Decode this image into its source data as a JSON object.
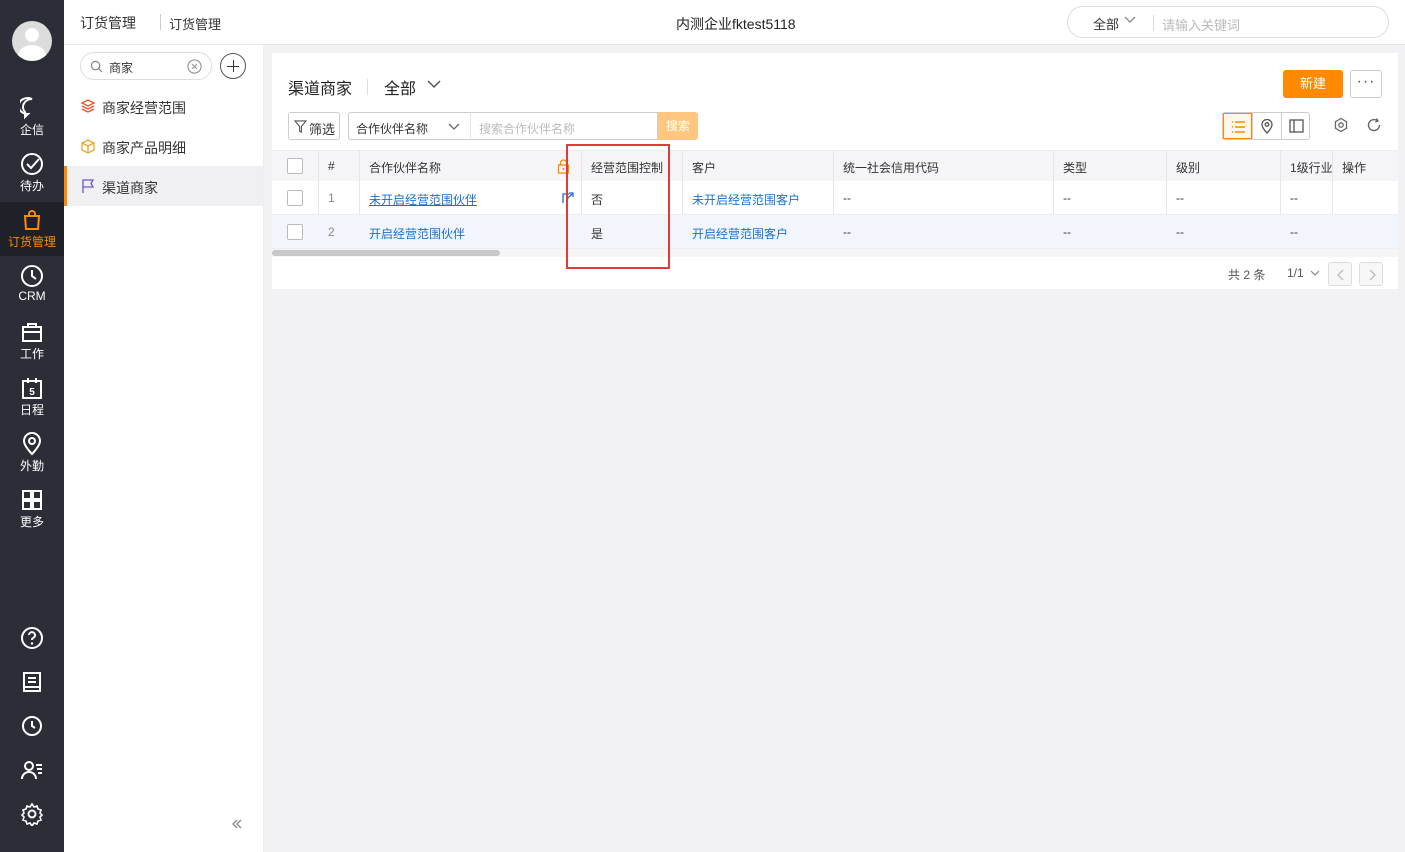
{
  "leftnav": {
    "items": [
      {
        "label": "企信",
        "icon": "chat-bubble-icon"
      },
      {
        "label": "待办",
        "icon": "check-circle-icon"
      },
      {
        "label": "订货管理",
        "icon": "shopping-bag-icon",
        "active": true
      },
      {
        "label": "CRM",
        "icon": "clock-pie-icon"
      },
      {
        "label": "工作",
        "icon": "briefcase-icon"
      },
      {
        "label": "日程",
        "icon": "calendar-icon",
        "calendar_day": "5"
      },
      {
        "label": "外勤",
        "icon": "location-pin-icon"
      },
      {
        "label": "更多",
        "icon": "grid-icon"
      }
    ],
    "bottom_icons": [
      "help-icon",
      "notebook-icon",
      "history-icon",
      "contacts-icon",
      "settings-icon"
    ]
  },
  "topbar": {
    "crumb_app": "订货管理",
    "crumb_page": "订货管理",
    "company": "内测企业fktest5118",
    "search_scope": "全部",
    "search_placeholder": "请输入关键词"
  },
  "subside": {
    "search_value": "商家",
    "items": [
      {
        "label": "商家经营范围",
        "icon": "layers-icon"
      },
      {
        "label": "商家产品明细",
        "icon": "box-icon"
      },
      {
        "label": "渠道商家",
        "icon": "flag-icon",
        "active": true
      }
    ]
  },
  "main": {
    "title": "渠道商家",
    "scope": "全部",
    "new_button": "新建",
    "more_button": "···",
    "filter_button": "筛选",
    "field_select": "合作伙伴名称",
    "search_placeholder": "搜索合作伙伴名称",
    "search_button": "搜索"
  },
  "table": {
    "columns": [
      "#",
      "合作伙伴名称",
      "经营范围控制",
      "客户",
      "统一社会信用代码",
      "类型",
      "级别",
      "1级行业",
      "操作"
    ],
    "rows": [
      {
        "num": "1",
        "partner": "未开启经营范围伙伴",
        "scope_control": "否",
        "customer": "未开启经营范围客户",
        "credit_code": "--",
        "type": "--",
        "level": "--",
        "industry": "--"
      },
      {
        "num": "2",
        "partner": "开启经营范围伙伴",
        "scope_control": "是",
        "customer": "开启经营范围客户",
        "credit_code": "--",
        "type": "--",
        "level": "--",
        "industry": "--"
      }
    ]
  },
  "pagination": {
    "total": "共 2 条",
    "page": "1/1"
  },
  "colors": {
    "accent": "#ff8a00",
    "nav_bg": "#2b2e36",
    "link": "#1a6fd1",
    "highlight_box": "#e03a3a"
  }
}
